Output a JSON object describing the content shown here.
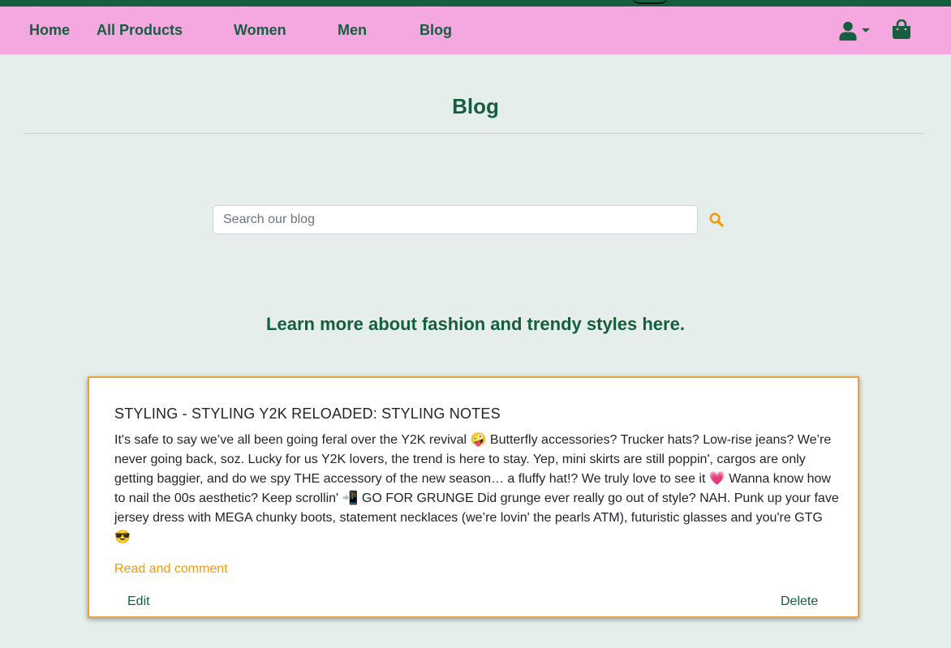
{
  "colors": {
    "brand_green": "#155e40",
    "nav_pink": "#f4a8df",
    "page_bg": "#e5eeea",
    "accent_orange": "#f59a0a"
  },
  "nav": {
    "items": [
      {
        "label": "Home"
      },
      {
        "label": "All Products"
      },
      {
        "label": "Women"
      },
      {
        "label": "Men"
      },
      {
        "label": "Blog"
      }
    ],
    "account_icon": "user-icon",
    "bag_icon": "shopping-bag-icon"
  },
  "page": {
    "title": "Blog",
    "tagline": "Learn more about fashion and trendy styles here."
  },
  "search": {
    "placeholder": "Search our blog",
    "value": "",
    "icon": "search-icon"
  },
  "post": {
    "title": "STYLING - STYLING Y2K RELOADED: STYLING NOTES",
    "excerpt": "It's safe to say we’ve all been going feral over the Y2K revival 🤪 Butterfly accessories? Trucker hats? Low-rise jeans? We’re never going back, soz. Lucky for us Y2K lovers, the trend is here to stay. Yep, mini skirts are still poppin', cargos are only getting baggier, and do we spy THE accessory of the new season… a fluffy hat!? We truly love to see it 💗 Wanna know how to nail the 00s aesthetic? Keep scrollin' 📲 GO FOR GRUNGE Did grunge ever really go out of style? NAH. Punk up your fave jersey dress with MEGA chunky boots, statement necklaces (we’re lovin' the pearls ATM), futuristic glasses and you're GTG 😎",
    "read_link": "Read and comment",
    "edit_label": "Edit",
    "delete_label": "Delete"
  }
}
